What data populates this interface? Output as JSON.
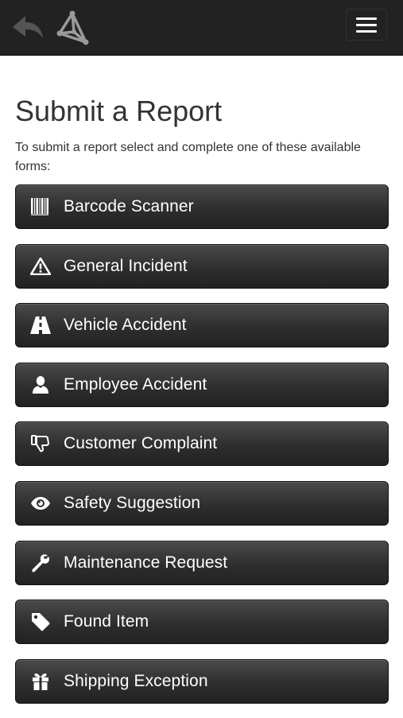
{
  "navbar": {
    "back_icon": "back-arrow-icon",
    "logo_icon": "triangle-logo-icon",
    "menu_icon": "hamburger-menu-icon"
  },
  "page": {
    "title": "Submit a Report",
    "intro": "To submit a report select and complete one of these available forms:"
  },
  "forms": [
    {
      "label": "Barcode Scanner",
      "icon": "barcode-icon"
    },
    {
      "label": "General Incident",
      "icon": "warning-icon"
    },
    {
      "label": "Vehicle Accident",
      "icon": "road-icon"
    },
    {
      "label": "Employee Accident",
      "icon": "user-icon"
    },
    {
      "label": "Customer Complaint",
      "icon": "thumbs-down-icon"
    },
    {
      "label": "Safety Suggestion",
      "icon": "eye-icon"
    },
    {
      "label": "Maintenance Request",
      "icon": "wrench-icon"
    },
    {
      "label": "Found Item",
      "icon": "tag-icon"
    },
    {
      "label": "Shipping Exception",
      "icon": "gift-icon"
    }
  ],
  "colors": {
    "navbar_bg": "#222222",
    "button_bg": "#2e2e2e",
    "text": "#333333"
  }
}
